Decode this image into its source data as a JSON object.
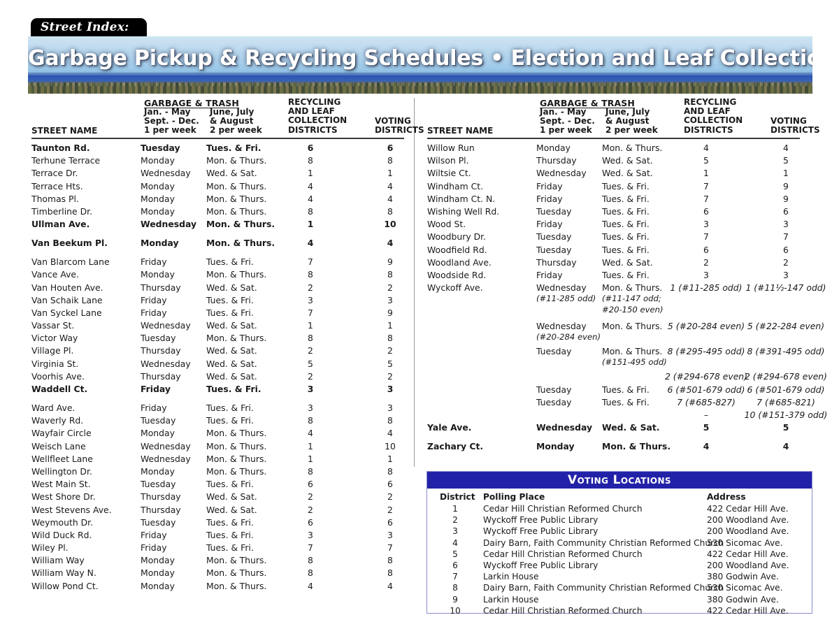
{
  "masthead": {
    "tab_label": "Street Index:",
    "banner_title": "Garbage Pickup & Recycling Schedules • Election and Leaf Collection Districts"
  },
  "colors": {
    "voting_header_bg": "#2222A8",
    "voting_box_border": "#8B8BD0",
    "tab_bg": "#000000",
    "text": "#1A1A1A"
  },
  "table_header": {
    "garbage_trash": "GARBAGE & TRASH",
    "col_jan_may": "Jan. - May\nSept. - Dec.\n1 per week",
    "col_jan_may_l1": "Jan. - May",
    "col_jan_may_l2": "Sept. - Dec.",
    "col_jan_may_l3": "1 per week",
    "col_june_aug_l1": "June, July",
    "col_june_aug_l2": "& August",
    "col_june_aug_l3": "2 per week",
    "col_recycling_l1": "RECYCLING",
    "col_recycling_l2": "AND LEAF",
    "col_recycling_l3": "COLLECTION",
    "col_recycling_l4": "DISTRICTS",
    "col_voting_l1": "VOTING",
    "col_voting_l2": "DISTRICTS",
    "col_street_name": "STREET NAME"
  },
  "left_column": {
    "groups": [
      {
        "rows": [
          {
            "name": "Taunton Rd.",
            "g1": "Tuesday",
            "g2": "Tues. & Fri.",
            "rec": "6",
            "vote": "6",
            "bold": true
          },
          {
            "name": "Terhune Terrace",
            "g1": "Monday",
            "g2": "Mon. & Thurs.",
            "rec": "8",
            "vote": "8"
          },
          {
            "name": "Terrace Dr.",
            "g1": "Wednesday",
            "g2": "Wed. & Sat.",
            "rec": "1",
            "vote": "1"
          },
          {
            "name": "Terrace Hts.",
            "g1": "Monday",
            "g2": "Mon. & Thurs.",
            "rec": "4",
            "vote": "4"
          },
          {
            "name": "Thomas Pl.",
            "g1": "Monday",
            "g2": "Mon. & Thurs.",
            "rec": "4",
            "vote": "4"
          },
          {
            "name": "Timberline Dr.",
            "g1": "Monday",
            "g2": "Mon. & Thurs.",
            "rec": "8",
            "vote": "8"
          }
        ]
      },
      {
        "rows": [
          {
            "name": "Ullman Ave.",
            "g1": "Wednesday",
            "g2": "Mon. & Thurs.",
            "rec": "1",
            "vote": "10",
            "bold": true
          }
        ]
      },
      {
        "rows": [
          {
            "name": "Van Beekum Pl.",
            "g1": "Monday",
            "g2": "Mon. & Thurs.",
            "rec": "4",
            "vote": "4",
            "bold": true
          },
          {
            "name": "Van Blarcom Lane",
            "g1": "Friday",
            "g2": "Tues. & Fri.",
            "rec": "7",
            "vote": "9"
          },
          {
            "name": "Vance Ave.",
            "g1": "Monday",
            "g2": "Mon. & Thurs.",
            "rec": "8",
            "vote": "8"
          },
          {
            "name": "Van Houten Ave.",
            "g1": "Thursday",
            "g2": "Wed. & Sat.",
            "rec": "2",
            "vote": "2"
          },
          {
            "name": "Van Schaik Lane",
            "g1": "Friday",
            "g2": "Tues. & Fri.",
            "rec": "3",
            "vote": "3"
          },
          {
            "name": "Van Syckel Lane",
            "g1": "Friday",
            "g2": "Tues. & Fri.",
            "rec": "7",
            "vote": "9"
          },
          {
            "name": "Vassar St.",
            "g1": "Wednesday",
            "g2": "Wed. & Sat.",
            "rec": "1",
            "vote": "1"
          },
          {
            "name": "Victor Way",
            "g1": "Tuesday",
            "g2": "Mon. & Thurs.",
            "rec": "8",
            "vote": "8"
          },
          {
            "name": "Village Pl.",
            "g1": "Thursday",
            "g2": "Wed. & Sat.",
            "rec": "2",
            "vote": "2"
          },
          {
            "name": "Virginia St.",
            "g1": "Wednesday",
            "g2": "Wed. & Sat.",
            "rec": "5",
            "vote": "5"
          },
          {
            "name": "Voorhis Ave.",
            "g1": "Thursday",
            "g2": "Wed. & Sat.",
            "rec": "2",
            "vote": "2"
          }
        ]
      },
      {
        "rows": [
          {
            "name": "Waddell Ct.",
            "g1": "Friday",
            "g2": "Tues. & Fri.",
            "rec": "3",
            "vote": "3",
            "bold": true
          },
          {
            "name": "Ward Ave.",
            "g1": "Friday",
            "g2": "Tues. & Fri.",
            "rec": "3",
            "vote": "3"
          },
          {
            "name": "Waverly Rd.",
            "g1": "Tuesday",
            "g2": "Tues. & Fri.",
            "rec": "8",
            "vote": "8"
          },
          {
            "name": "Wayfair Circle",
            "g1": "Monday",
            "g2": "Mon. & Thurs.",
            "rec": "4",
            "vote": "4"
          },
          {
            "name": "Weisch Lane",
            "g1": "Wednesday",
            "g2": "Mon. & Thurs.",
            "rec": "1",
            "vote": "10"
          },
          {
            "name": "Wellfleet Lane",
            "g1": "Wednesday",
            "g2": "Mon. & Thurs.",
            "rec": "1",
            "vote": "1"
          },
          {
            "name": "Wellington Dr.",
            "g1": "Monday",
            "g2": "Mon. & Thurs.",
            "rec": "8",
            "vote": "8"
          },
          {
            "name": "West Main St.",
            "g1": "Tuesday",
            "g2": "Tues. & Fri.",
            "rec": "6",
            "vote": "6"
          },
          {
            "name": "West Shore Dr.",
            "g1": "Thursday",
            "g2": "Wed. & Sat.",
            "rec": "2",
            "vote": "2"
          },
          {
            "name": "West Stevens Ave.",
            "g1": "Thursday",
            "g2": "Wed. & Sat.",
            "rec": "2",
            "vote": "2"
          },
          {
            "name": "Weymouth Dr.",
            "g1": "Tuesday",
            "g2": "Tues. & Fri.",
            "rec": "6",
            "vote": "6"
          },
          {
            "name": "Wild Duck Rd.",
            "g1": "Friday",
            "g2": "Tues. & Fri.",
            "rec": "3",
            "vote": "3"
          },
          {
            "name": "Wiley Pl.",
            "g1": "Friday",
            "g2": "Tues. & Fri.",
            "rec": "7",
            "vote": "7"
          },
          {
            "name": "William Way",
            "g1": "Monday",
            "g2": "Mon. & Thurs.",
            "rec": "8",
            "vote": "8"
          },
          {
            "name": "William Way N.",
            "g1": "Monday",
            "g2": "Mon. & Thurs.",
            "rec": "8",
            "vote": "8"
          },
          {
            "name": "Willow Pond Ct.",
            "g1": "Monday",
            "g2": "Mon. & Thurs.",
            "rec": "4",
            "vote": "4"
          }
        ]
      }
    ]
  },
  "right_column": {
    "groups": [
      {
        "rows": [
          {
            "name": "Willow Run",
            "g1": "Monday",
            "g2": "Mon. & Thurs.",
            "rec": "4",
            "vote": "4"
          },
          {
            "name": "Wilson Pl.",
            "g1": "Thursday",
            "g2": "Wed. & Sat.",
            "rec": "5",
            "vote": "5"
          },
          {
            "name": "Wiltsie Ct.",
            "g1": "Wednesday",
            "g2": "Wed. & Sat.",
            "rec": "1",
            "vote": "1"
          },
          {
            "name": "Windham Ct.",
            "g1": "Friday",
            "g2": "Tues. & Fri.",
            "rec": "7",
            "vote": "9"
          },
          {
            "name": "Windham Ct. N.",
            "g1": "Friday",
            "g2": "Tues. & Fri.",
            "rec": "7",
            "vote": "9"
          },
          {
            "name": "Wishing Well Rd.",
            "g1": "Tuesday",
            "g2": "Tues. & Fri.",
            "rec": "6",
            "vote": "6"
          },
          {
            "name": "Wood St.",
            "g1": "Friday",
            "g2": "Tues. & Fri.",
            "rec": "3",
            "vote": "3"
          },
          {
            "name": "Woodbury Dr.",
            "g1": "Tuesday",
            "g2": "Tues. & Fri.",
            "rec": "7",
            "vote": "7"
          },
          {
            "name": "Woodfield Rd.",
            "g1": "Tuesday",
            "g2": "Tues. & Fri.",
            "rec": "6",
            "vote": "6"
          },
          {
            "name": "Woodland Ave.",
            "g1": "Thursday",
            "g2": "Wed. & Sat.",
            "rec": "2",
            "vote": "2"
          },
          {
            "name": "Woodside Rd.",
            "g1": "Friday",
            "g2": "Tues. & Fri.",
            "rec": "3",
            "vote": "3"
          }
        ]
      }
    ],
    "wyckoff": {
      "name": "Wyckoff Ave.",
      "lines": [
        {
          "g1": "Wednesday",
          "g1_sub": "(#11-285 odd)",
          "g2": "Mon. & Thurs.",
          "g2_sub": "(#11-147 odd;",
          "g2_sub2": "#20-150 even)",
          "rec": "1 (#11-285 odd)",
          "vote": "1 (#11½-147 odd)",
          "height": "h3"
        },
        {
          "g1": "Wednesday",
          "g1_sub": "(#20-284 even)",
          "g2": "Mon. & Thurs.",
          "g2_sub": "",
          "g2_sub2": "",
          "rec": "5 (#20-284 even)",
          "vote": "5 (#22-284 even)",
          "height": "h2"
        },
        {
          "g1": "Tuesday",
          "g1_sub": "",
          "g2": "Mon. & Thurs.",
          "g2_sub": "(#151-495 odd)",
          "g2_sub2": "",
          "rec": "8 (#295-495 odd)",
          "vote": "8 (#391-495 odd)",
          "height": "h2"
        },
        {
          "g1": "",
          "g1_sub": "",
          "g2": "",
          "g2_sub": "",
          "g2_sub2": "",
          "rec": "2 (#294-678 even)",
          "vote": "2 (#294-678 even)",
          "height": "h1"
        },
        {
          "g1": "Tuesday",
          "g1_sub": "",
          "g2": "Tues. & Fri.",
          "g2_sub": "",
          "g2_sub2": "",
          "rec": "6 (#501-679 odd)",
          "vote": "6 (#501-679 odd)",
          "height": "h1"
        },
        {
          "g1": "Tuesday",
          "g1_sub": "",
          "g2": "Tues. & Fri.",
          "g2_sub": "",
          "g2_sub2": "",
          "rec": "7 (#685-827)",
          "vote": "7 (#685-821)",
          "height": "h1"
        },
        {
          "g1": "",
          "g1_sub": "",
          "g2": "",
          "g2_sub": "",
          "g2_sub2": "",
          "rec": "–",
          "vote": "10 (#151-379 odd)",
          "height": "h1"
        }
      ]
    },
    "tail_groups": [
      {
        "rows": [
          {
            "name": "Yale Ave.",
            "g1": "Wednesday",
            "g2": "Wed. & Sat.",
            "rec": "5",
            "vote": "5",
            "bold": true
          }
        ]
      },
      {
        "rows": [
          {
            "name": "Zachary Ct.",
            "g1": "Monday",
            "g2": "Mon. & Thurs.",
            "rec": "4",
            "vote": "4",
            "bold": true
          }
        ]
      }
    ]
  },
  "voting_locations": {
    "title": "Voting Locations",
    "headers": {
      "district": "District",
      "polling_place": "Polling Place",
      "address": "Address"
    },
    "rows": [
      {
        "district": "1",
        "place": "Cedar Hill Christian Reformed Church",
        "address": "422 Cedar Hill Ave."
      },
      {
        "district": "2",
        "place": "Wyckoff Free Public Library",
        "address": "200 Woodland Ave."
      },
      {
        "district": "3",
        "place": "Wyckoff Free Public Library",
        "address": "200 Woodland Ave."
      },
      {
        "district": "4",
        "place": "Dairy Barn, Faith Community Christian Reformed Church",
        "address": "530 Sicomac Ave."
      },
      {
        "district": "5",
        "place": "Cedar Hill Christian Reformed Church",
        "address": "422 Cedar Hill Ave."
      },
      {
        "district": "6",
        "place": "Wyckoff Free Public Library",
        "address": "200 Woodland Ave."
      },
      {
        "district": "7",
        "place": "Larkin House",
        "address": "380 Godwin Ave."
      },
      {
        "district": "8",
        "place": "Dairy Barn, Faith Community Christian Reformed Church",
        "address": "530 Sicomac Ave."
      },
      {
        "district": "9",
        "place": "Larkin House",
        "address": "380 Godwin Ave."
      },
      {
        "district": "10",
        "place": "Cedar Hill Christian Reformed Church",
        "address": "422 Cedar Hill Ave."
      }
    ]
  }
}
